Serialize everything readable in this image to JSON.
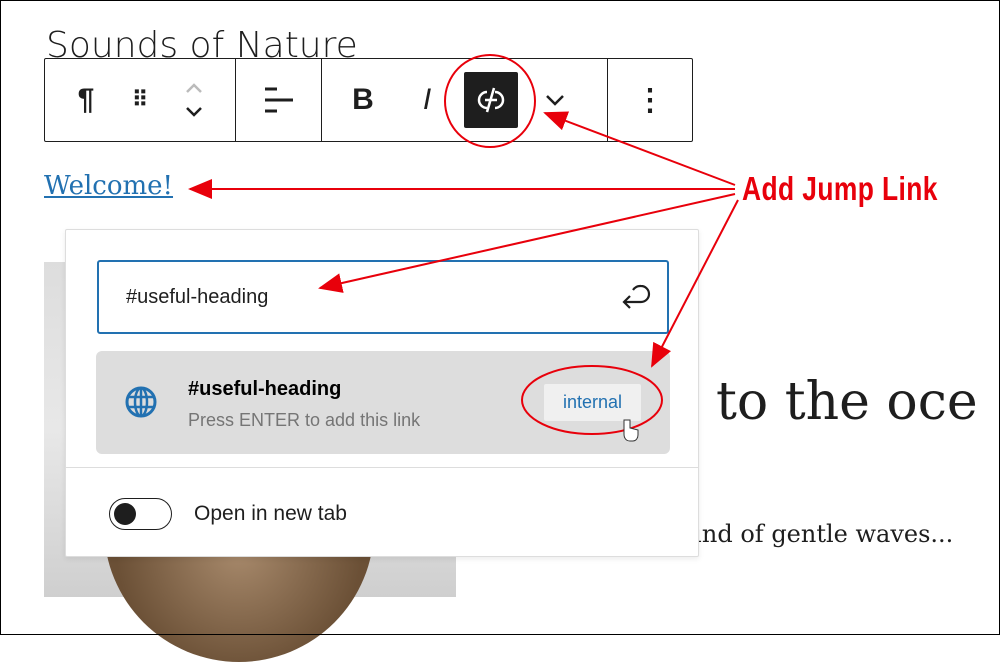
{
  "page": {
    "title": "Sounds of Nature",
    "link_text": "Welcome!",
    "heading_partial": "to the oce",
    "paragraph_partial": "ound of gentle waves..."
  },
  "toolbar": {
    "items": [
      {
        "name": "paragraph",
        "glyph": "¶"
      },
      {
        "name": "drag",
        "glyph": "⠿"
      },
      {
        "name": "move",
        "glyph": "⌃⌄"
      },
      {
        "name": "align",
        "glyph": "≡"
      },
      {
        "name": "bold",
        "glyph": "B"
      },
      {
        "name": "italic",
        "glyph": "I"
      },
      {
        "name": "unlink",
        "active": true
      },
      {
        "name": "more-rich-text",
        "glyph": "⌄"
      },
      {
        "name": "options",
        "glyph": "⋮"
      }
    ]
  },
  "link_popover": {
    "input_value": "#useful-heading",
    "suggestion": {
      "title": "#useful-heading",
      "subtitle": "Press ENTER to add this link",
      "type_badge": "internal"
    },
    "open_new_tab": {
      "label": "Open in new tab",
      "checked": false
    }
  },
  "annotation": {
    "label": "Add Jump Link",
    "color": "#e8000b"
  },
  "colors": {
    "accent": "#2271b1",
    "toolbar_active": "#1e1e1e"
  }
}
